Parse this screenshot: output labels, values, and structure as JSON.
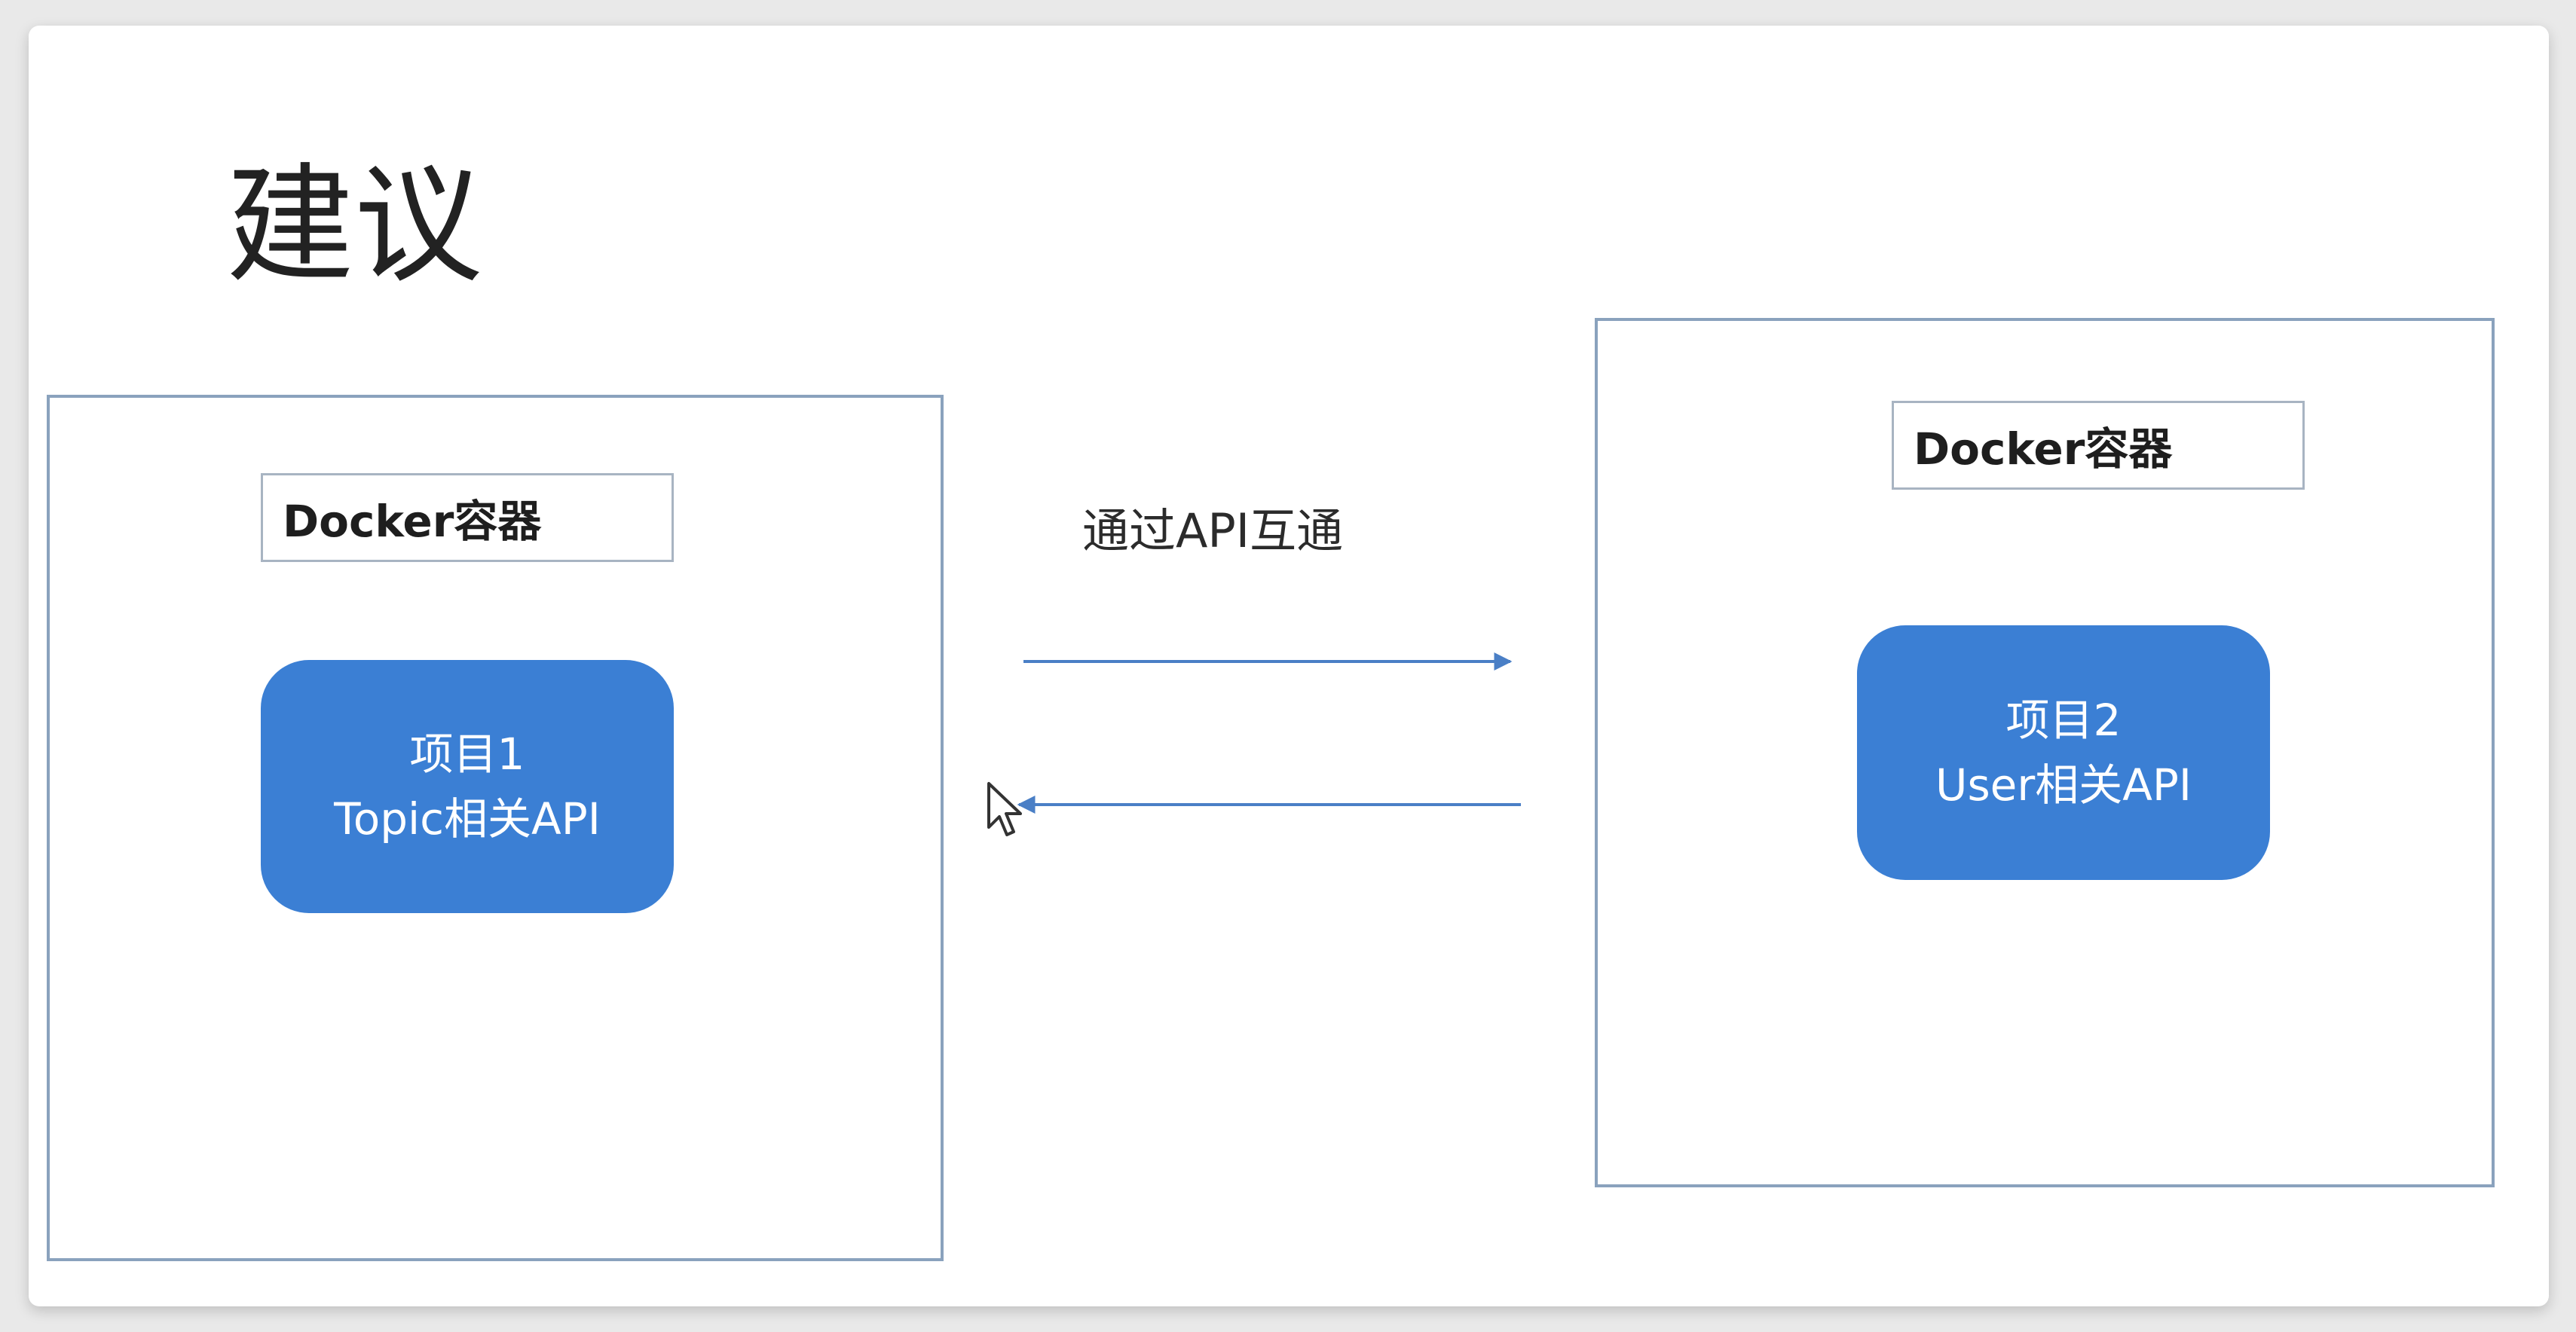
{
  "slide": {
    "title": "建议"
  },
  "left": {
    "container_label": "Docker容器",
    "project_line1": "项目1",
    "project_line2": "Topic相关API"
  },
  "right": {
    "container_label": "Docker容器",
    "project_line1": "项目2",
    "project_line2": "User相关API"
  },
  "connection": {
    "label": "通过API互通"
  },
  "colors": {
    "project_fill": "#3b7fd4",
    "container_border": "#8aa2bd",
    "arrow": "#4a7fc6"
  },
  "icons": {
    "cursor": "mouse-pointer-icon"
  }
}
